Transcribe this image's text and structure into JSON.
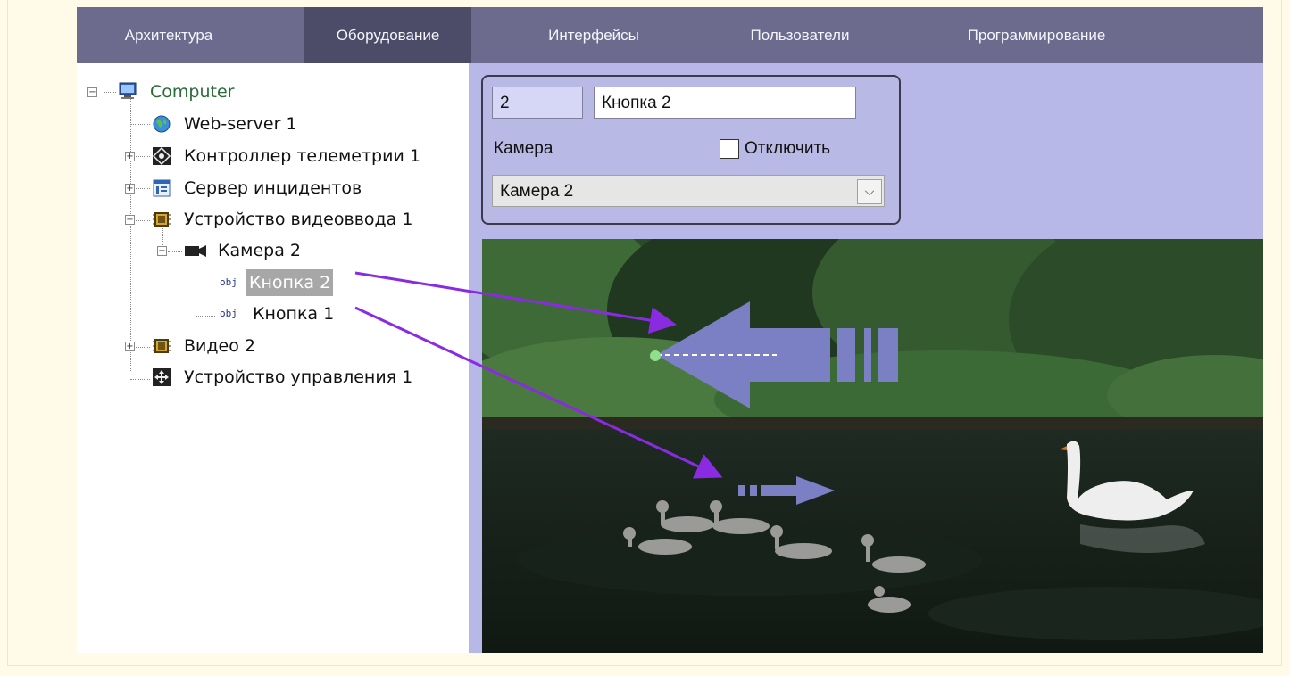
{
  "tabs": [
    {
      "label": "Архитектура",
      "active": false
    },
    {
      "label": "Оборудование",
      "active": true
    },
    {
      "label": "Интерфейсы",
      "active": false
    },
    {
      "label": "Пользователи",
      "active": false
    },
    {
      "label": "Программирование",
      "active": false
    }
  ],
  "tree": [
    {
      "label": "Computer",
      "icon": "computer-icon",
      "expanded": true
    },
    {
      "label": "Web-server 1",
      "icon": "globe-icon"
    },
    {
      "label": "Контроллер телеметрии 1",
      "icon": "telemetry-controller-icon",
      "expanded": false
    },
    {
      "label": "Сервер инцидентов",
      "icon": "incident-server-icon",
      "expanded": false
    },
    {
      "label": "Устройство видеоввода 1",
      "icon": "video-capture-icon",
      "expanded": true
    },
    {
      "label": "Камера 2",
      "icon": "camera-icon",
      "expanded": true
    },
    {
      "label": "Кнопка 2",
      "icon": "obj-icon",
      "obj_text": "obj",
      "selected": true
    },
    {
      "label": "Кнопка 1",
      "icon": "obj-icon",
      "obj_text": "obj"
    },
    {
      "label": "Видео 2",
      "icon": "video-capture-icon",
      "expanded": false
    },
    {
      "label": "Устройство управления 1",
      "icon": "control-device-icon"
    }
  ],
  "props": {
    "id_value": "2",
    "name_value": "Кнопка 2",
    "camera_label": "Камера",
    "disable_label": "Отключить",
    "disable_checked": false,
    "camera_selected": "Камера 2"
  },
  "colors": {
    "tabbar": "#6c6b8e",
    "tab_active": "#4c4b68",
    "panel": "#b8b8e8",
    "annotation_arrow": "#8a2be2",
    "overlay_button": "#7b7fc4"
  }
}
